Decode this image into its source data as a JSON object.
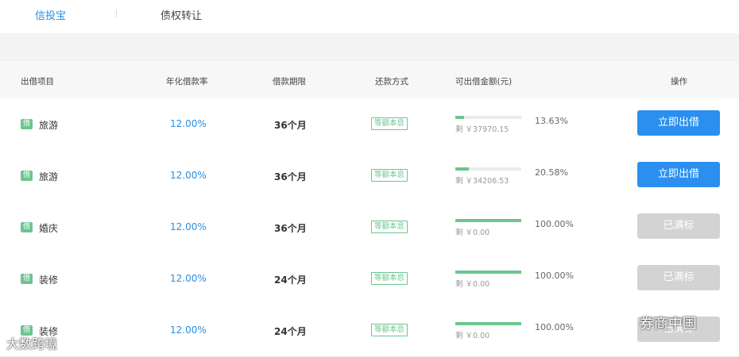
{
  "tabs": {
    "active": "信投宝",
    "other": "债权转让"
  },
  "table": {
    "headers": {
      "project": "出借项目",
      "rate": "年化借款率",
      "term": "借款期限",
      "method": "还款方式",
      "amount": "可出借金额(元)",
      "action": "操作"
    },
    "rows": [
      {
        "badge": "借",
        "project": "旅游",
        "rate": "12.00%",
        "term": "36个月",
        "method": "等额本息",
        "progress": 0.1363,
        "remain": "剩 ￥37970.15",
        "percent": "13.63%",
        "button": "立即出借",
        "status": "open"
      },
      {
        "badge": "借",
        "project": "旅游",
        "rate": "12.00%",
        "term": "36个月",
        "method": "等额本息",
        "progress": 0.2058,
        "remain": "剩 ￥34206.53",
        "percent": "20.58%",
        "button": "立即出借",
        "status": "open"
      },
      {
        "badge": "借",
        "project": "婚庆",
        "rate": "12.00%",
        "term": "36个月",
        "method": "等额本息",
        "progress": 1.0,
        "remain": "剩 ￥0.00",
        "percent": "100.00%",
        "button": "已满标",
        "status": "full"
      },
      {
        "badge": "借",
        "project": "装修",
        "rate": "12.00%",
        "term": "24个月",
        "method": "等额本息",
        "progress": 1.0,
        "remain": "剩 ￥0.00",
        "percent": "100.00%",
        "button": "已满标",
        "status": "full"
      },
      {
        "badge": "借",
        "project": "装修",
        "rate": "12.00%",
        "term": "24个月",
        "method": "等额本息",
        "progress": 1.0,
        "remain": "剩 ￥0.00",
        "percent": "100.00%",
        "button": "已满标",
        "status": "full"
      }
    ]
  },
  "watermarks": {
    "left": "大数跨境",
    "right": "券商中国"
  },
  "colors": {
    "accent": "#2a8fe0",
    "green": "#6cc58f",
    "disabled": "#d3d3d3"
  }
}
